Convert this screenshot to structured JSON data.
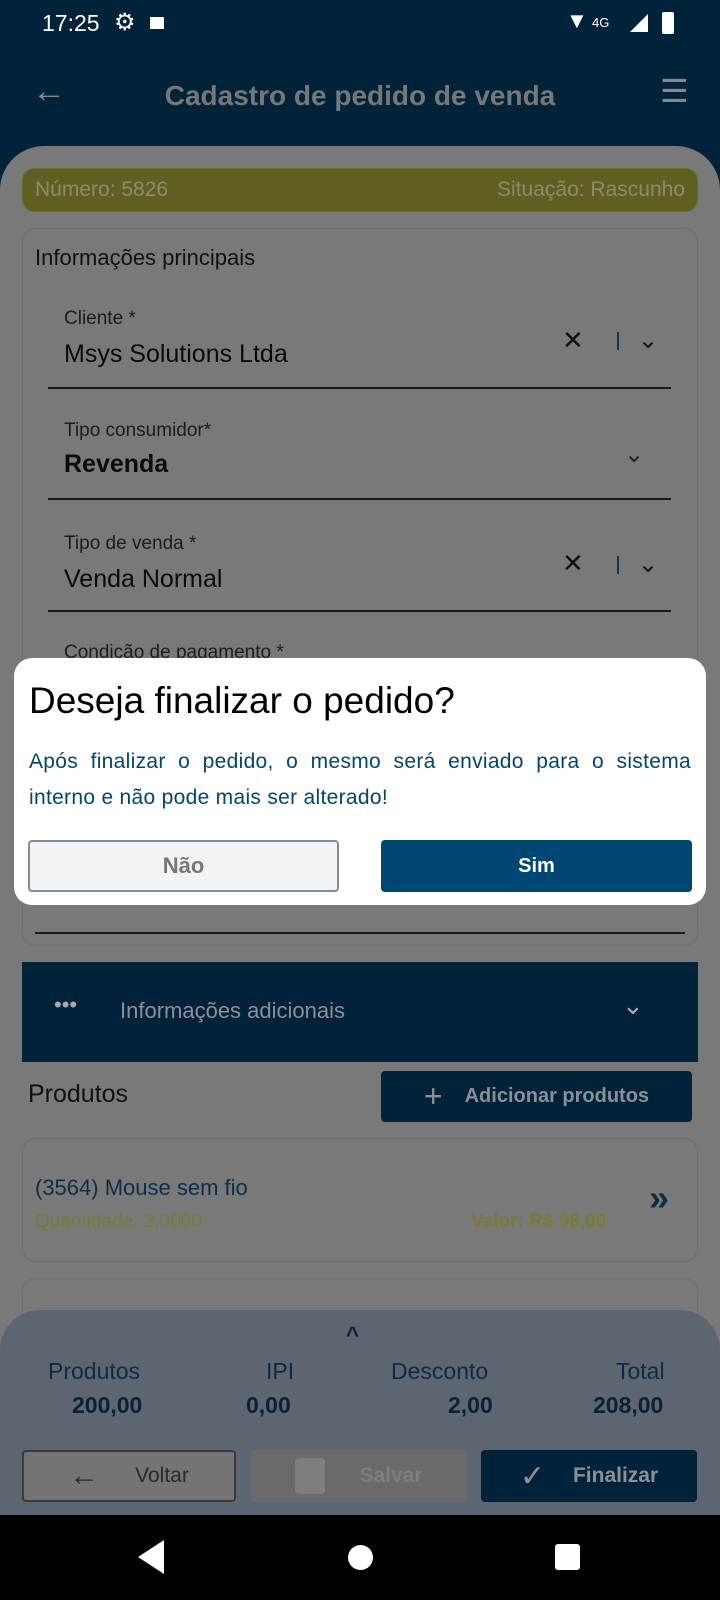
{
  "status_bar": {
    "time": "17:25",
    "network": "4G"
  },
  "app_bar": {
    "title": "Cadastro de pedido de venda"
  },
  "banner": {
    "number": "Número: 5826",
    "status": "Situação: Rascunho"
  },
  "main_info": {
    "title": "Informações principais",
    "fields": [
      {
        "label": "Cliente *",
        "value": "Msys Solutions Ltda"
      },
      {
        "label": "Tipo consumidor*",
        "value": "Revenda"
      },
      {
        "label": "Tipo de venda *",
        "value": "Venda Normal"
      },
      {
        "label": "Condição de pagamento *",
        "value": ""
      }
    ]
  },
  "additional": {
    "label": "Informações adicionais"
  },
  "products": {
    "title": "Produtos",
    "add_label": "Adicionar produtos",
    "items": [
      {
        "name": "(3564) Mouse sem fio",
        "quantity": "Quantidade: 2,0000",
        "value": "Valor: R$ 98,00"
      }
    ]
  },
  "totals": [
    {
      "label": "Produtos",
      "value": "200,00"
    },
    {
      "label": "IPI",
      "value": "0,00"
    },
    {
      "label": "Desconto",
      "value": "2,00"
    },
    {
      "label": "Total",
      "value": "208,00"
    }
  ],
  "actions": {
    "back": "Voltar",
    "save": "Salvar",
    "finish": "Finalizar"
  },
  "dialog": {
    "title": "Deseja finalizar o pedido?",
    "message": "Após finalizar o pedido, o mesmo será enviado para o sistema interno e não pode mais ser alterado!",
    "no": "Não",
    "yes": "Sim"
  },
  "colors": {
    "primary": "#004672",
    "accent": "#b5b53a"
  }
}
